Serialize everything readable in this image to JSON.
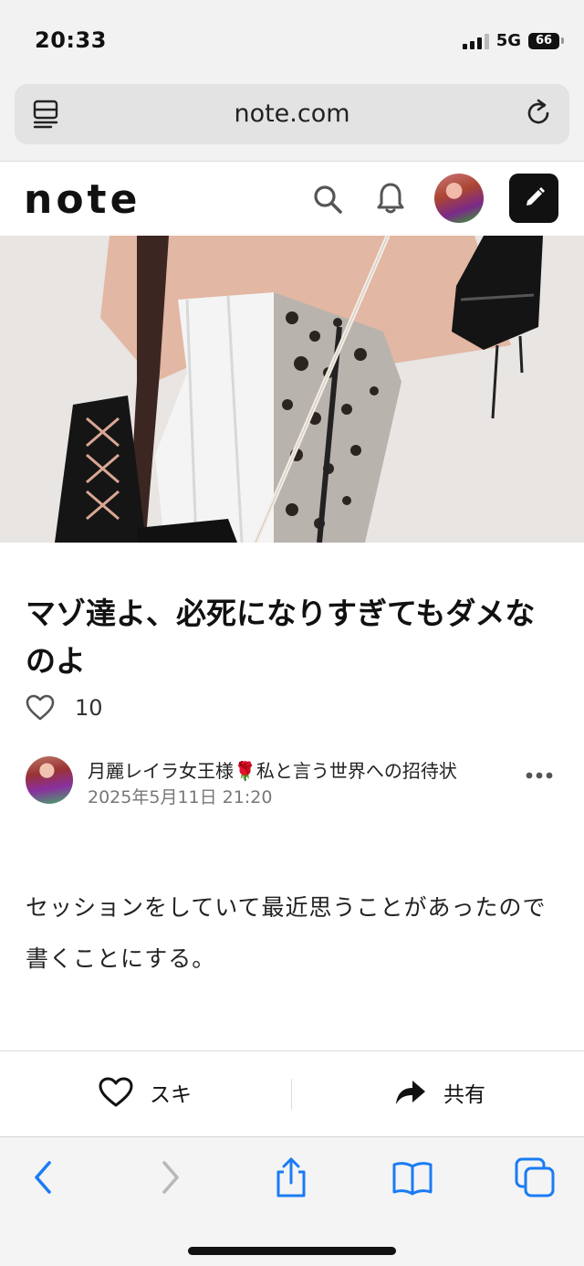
{
  "status_bar": {
    "time": "20:33",
    "network": "5G",
    "battery": "66"
  },
  "url_bar": {
    "domain": "note.com"
  },
  "header": {
    "logo": "note"
  },
  "article": {
    "title": "マゾ達よ、必死になりすぎてもダメなのよ",
    "like_count": "10",
    "author": "月麗レイラ女王様🌹私と言う世界への招待状",
    "date": "2025年5月11日 21:20",
    "body": "セッションをしていて最近思うことがあったので書くことにする。"
  },
  "action_bar": {
    "like_label": "スキ",
    "share_label": "共有"
  },
  "colors": {
    "accent_blue": "#1a7cf5",
    "disabled_gray": "#b8b8b8",
    "text": "#111111"
  }
}
